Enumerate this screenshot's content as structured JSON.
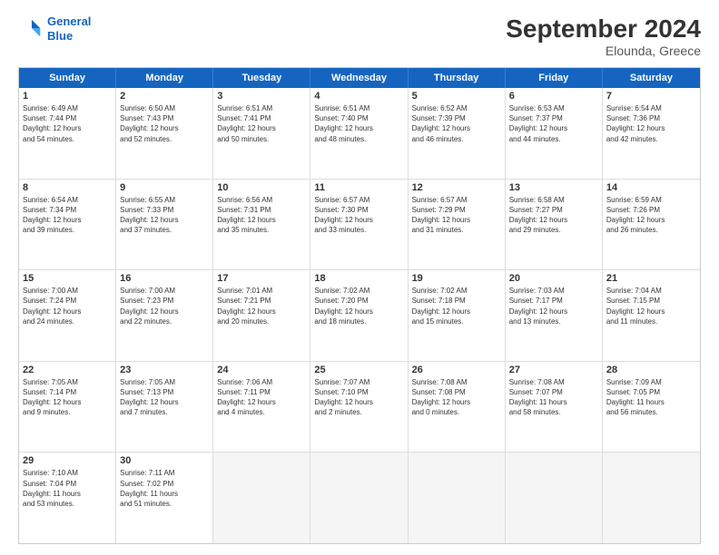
{
  "header": {
    "logo_line1": "General",
    "logo_line2": "Blue",
    "month": "September 2024",
    "location": "Elounda, Greece"
  },
  "days": [
    "Sunday",
    "Monday",
    "Tuesday",
    "Wednesday",
    "Thursday",
    "Friday",
    "Saturday"
  ],
  "rows": [
    [
      {
        "day": "",
        "text": ""
      },
      {
        "day": "2",
        "text": "Sunrise: 6:50 AM\nSunset: 7:43 PM\nDaylight: 12 hours\nand 52 minutes."
      },
      {
        "day": "3",
        "text": "Sunrise: 6:51 AM\nSunset: 7:41 PM\nDaylight: 12 hours\nand 50 minutes."
      },
      {
        "day": "4",
        "text": "Sunrise: 6:51 AM\nSunset: 7:40 PM\nDaylight: 12 hours\nand 48 minutes."
      },
      {
        "day": "5",
        "text": "Sunrise: 6:52 AM\nSunset: 7:39 PM\nDaylight: 12 hours\nand 46 minutes."
      },
      {
        "day": "6",
        "text": "Sunrise: 6:53 AM\nSunset: 7:37 PM\nDaylight: 12 hours\nand 44 minutes."
      },
      {
        "day": "7",
        "text": "Sunrise: 6:54 AM\nSunset: 7:36 PM\nDaylight: 12 hours\nand 42 minutes."
      }
    ],
    [
      {
        "day": "8",
        "text": "Sunrise: 6:54 AM\nSunset: 7:34 PM\nDaylight: 12 hours\nand 39 minutes."
      },
      {
        "day": "9",
        "text": "Sunrise: 6:55 AM\nSunset: 7:33 PM\nDaylight: 12 hours\nand 37 minutes."
      },
      {
        "day": "10",
        "text": "Sunrise: 6:56 AM\nSunset: 7:31 PM\nDaylight: 12 hours\nand 35 minutes."
      },
      {
        "day": "11",
        "text": "Sunrise: 6:57 AM\nSunset: 7:30 PM\nDaylight: 12 hours\nand 33 minutes."
      },
      {
        "day": "12",
        "text": "Sunrise: 6:57 AM\nSunset: 7:29 PM\nDaylight: 12 hours\nand 31 minutes."
      },
      {
        "day": "13",
        "text": "Sunrise: 6:58 AM\nSunset: 7:27 PM\nDaylight: 12 hours\nand 29 minutes."
      },
      {
        "day": "14",
        "text": "Sunrise: 6:59 AM\nSunset: 7:26 PM\nDaylight: 12 hours\nand 26 minutes."
      }
    ],
    [
      {
        "day": "15",
        "text": "Sunrise: 7:00 AM\nSunset: 7:24 PM\nDaylight: 12 hours\nand 24 minutes."
      },
      {
        "day": "16",
        "text": "Sunrise: 7:00 AM\nSunset: 7:23 PM\nDaylight: 12 hours\nand 22 minutes."
      },
      {
        "day": "17",
        "text": "Sunrise: 7:01 AM\nSunset: 7:21 PM\nDaylight: 12 hours\nand 20 minutes."
      },
      {
        "day": "18",
        "text": "Sunrise: 7:02 AM\nSunset: 7:20 PM\nDaylight: 12 hours\nand 18 minutes."
      },
      {
        "day": "19",
        "text": "Sunrise: 7:02 AM\nSunset: 7:18 PM\nDaylight: 12 hours\nand 15 minutes."
      },
      {
        "day": "20",
        "text": "Sunrise: 7:03 AM\nSunset: 7:17 PM\nDaylight: 12 hours\nand 13 minutes."
      },
      {
        "day": "21",
        "text": "Sunrise: 7:04 AM\nSunset: 7:15 PM\nDaylight: 12 hours\nand 11 minutes."
      }
    ],
    [
      {
        "day": "22",
        "text": "Sunrise: 7:05 AM\nSunset: 7:14 PM\nDaylight: 12 hours\nand 9 minutes."
      },
      {
        "day": "23",
        "text": "Sunrise: 7:05 AM\nSunset: 7:13 PM\nDaylight: 12 hours\nand 7 minutes."
      },
      {
        "day": "24",
        "text": "Sunrise: 7:06 AM\nSunset: 7:11 PM\nDaylight: 12 hours\nand 4 minutes."
      },
      {
        "day": "25",
        "text": "Sunrise: 7:07 AM\nSunset: 7:10 PM\nDaylight: 12 hours\nand 2 minutes."
      },
      {
        "day": "26",
        "text": "Sunrise: 7:08 AM\nSunset: 7:08 PM\nDaylight: 12 hours\nand 0 minutes."
      },
      {
        "day": "27",
        "text": "Sunrise: 7:08 AM\nSunset: 7:07 PM\nDaylight: 11 hours\nand 58 minutes."
      },
      {
        "day": "28",
        "text": "Sunrise: 7:09 AM\nSunset: 7:05 PM\nDaylight: 11 hours\nand 56 minutes."
      }
    ],
    [
      {
        "day": "29",
        "text": "Sunrise: 7:10 AM\nSunset: 7:04 PM\nDaylight: 11 hours\nand 53 minutes."
      },
      {
        "day": "30",
        "text": "Sunrise: 7:11 AM\nSunset: 7:02 PM\nDaylight: 11 hours\nand 51 minutes."
      },
      {
        "day": "",
        "text": ""
      },
      {
        "day": "",
        "text": ""
      },
      {
        "day": "",
        "text": ""
      },
      {
        "day": "",
        "text": ""
      },
      {
        "day": "",
        "text": ""
      }
    ]
  ],
  "first_row_special": {
    "day1": {
      "day": "1",
      "text": "Sunrise: 6:49 AM\nSunset: 7:44 PM\nDaylight: 12 hours\nand 54 minutes."
    }
  }
}
